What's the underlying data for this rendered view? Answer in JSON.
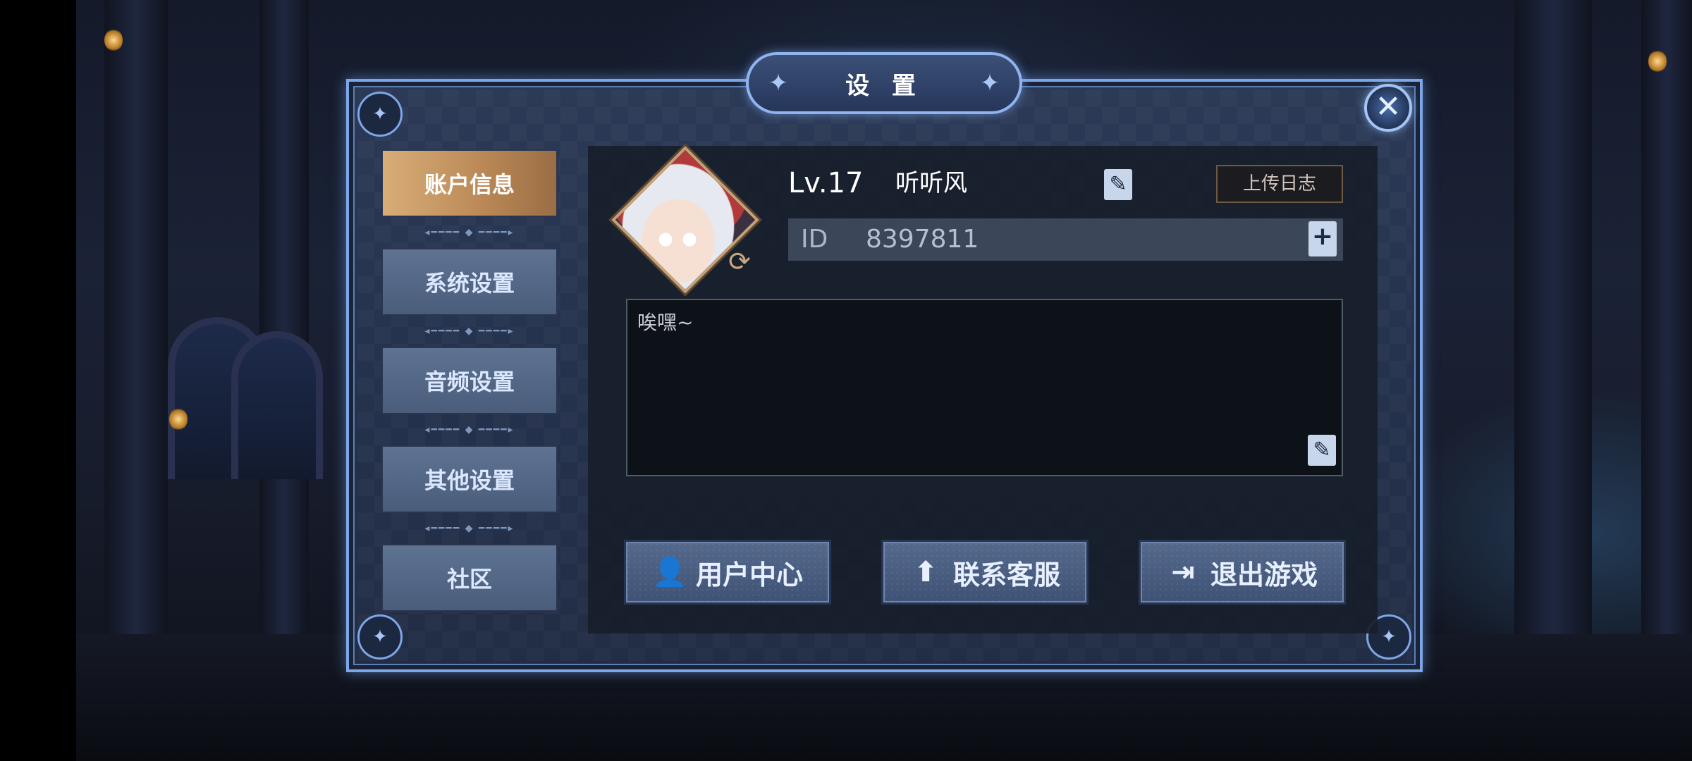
{
  "dialog": {
    "title": "设 置",
    "close_icon": "close-icon"
  },
  "tabs": [
    {
      "label": "账户信息",
      "active": true
    },
    {
      "label": "系统设置",
      "active": false
    },
    {
      "label": "音频设置",
      "active": false
    },
    {
      "label": "其他设置",
      "active": false
    },
    {
      "label": "社区",
      "active": false
    }
  ],
  "profile": {
    "level": "Lv.17",
    "nickname": "听听风",
    "upload_log_label": "上传日志",
    "id_label": "ID",
    "id_value": "8397811",
    "signature": "唉嘿~"
  },
  "actions": {
    "user_center": "用户中心",
    "contact_support": "联系客服",
    "exit_game": "退出游戏"
  },
  "colors": {
    "active_tab": "#c99a66",
    "tab": "#55698a",
    "frame": "#7ea6e6"
  }
}
